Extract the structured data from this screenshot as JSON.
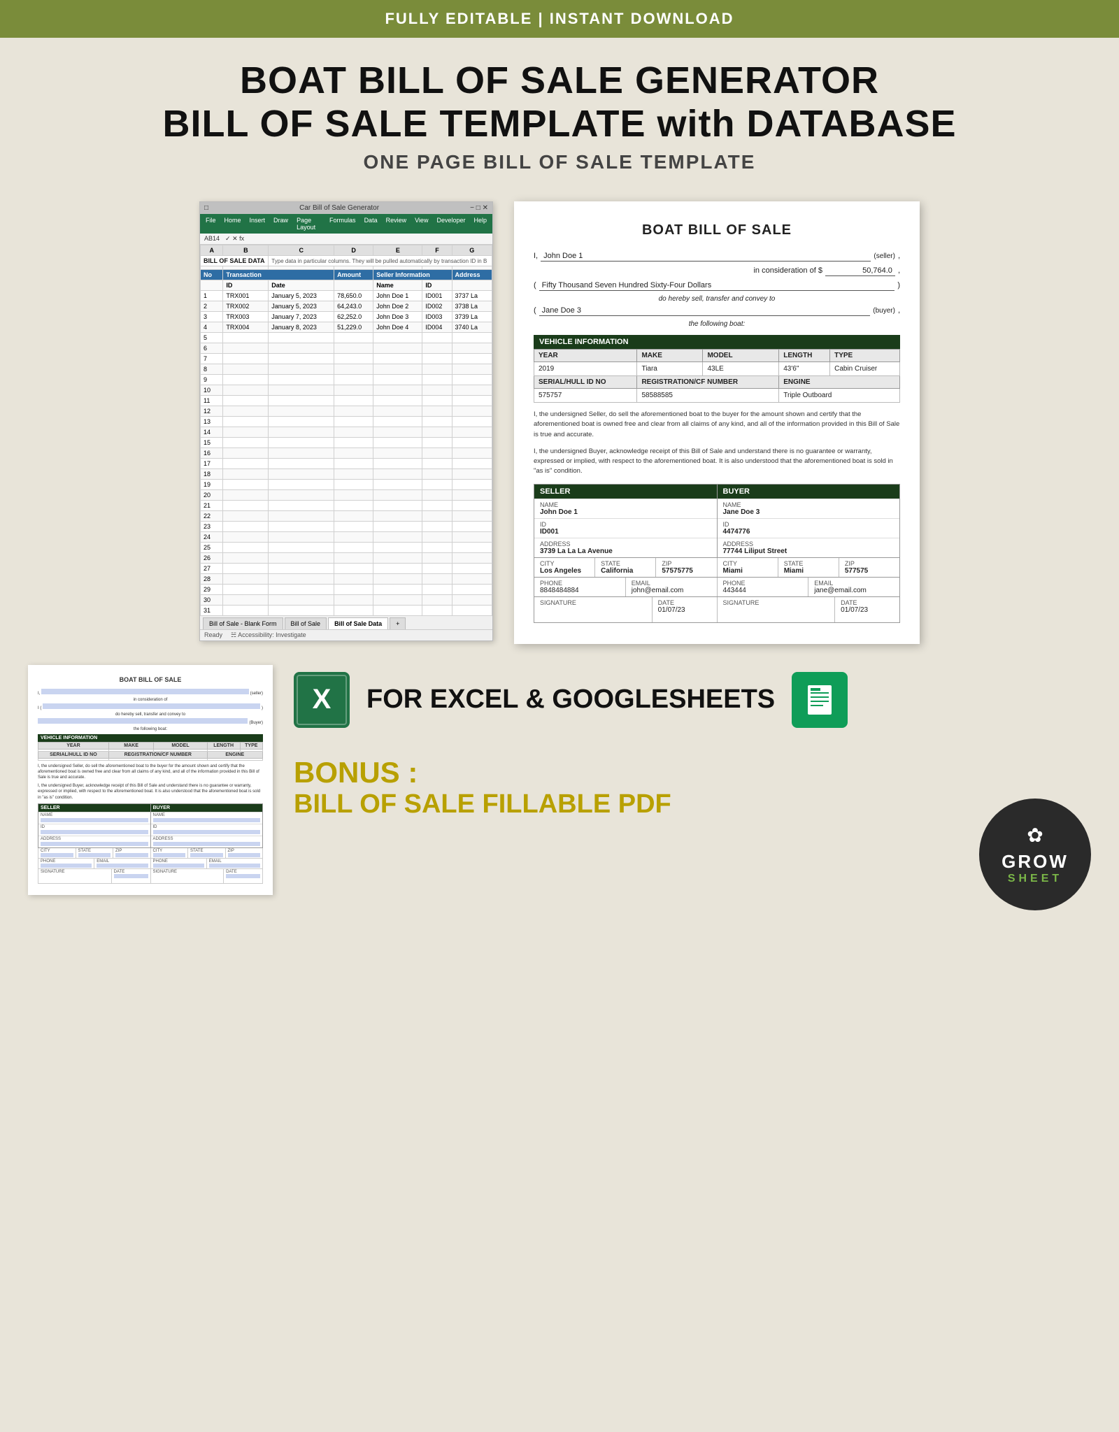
{
  "topBanner": {
    "text": "FULLY EDITABLE | INSTANT DOWNLOAD"
  },
  "mainTitle": {
    "line1": "BOAT BILL OF SALE GENERATOR",
    "line2": "BILL OF SALE TEMPLATE with DATABASE",
    "line3": "ONE PAGE BILL OF SALE TEMPLATE"
  },
  "excel": {
    "titleBar": "Car Bill of Sale Generator",
    "formulaBar": "AB14",
    "tabs": [
      "Bill of Sale - Blank Form",
      "Bill of Sale",
      "Bill of Sale Data"
    ],
    "activeTab": "Bill of Sale Data",
    "sheetTitle": "BILL OF SALE DATA",
    "sheetSubtitle": "Type data in particular columns. They will be pulled automatically by transaction ID in B",
    "columnHeaders": [
      "A",
      "B",
      "C",
      "D",
      "E",
      "F",
      "G"
    ],
    "tableHeaders": [
      "No",
      "Transaction",
      "",
      "Amount",
      "Seller Information",
      "",
      "ID",
      "Address"
    ],
    "subHeaders": [
      "",
      "ID",
      "Date",
      "",
      "Name",
      "",
      "",
      ""
    ],
    "rows": [
      {
        "no": "1",
        "id": "TRX001",
        "date": "January 5, 2023",
        "amount": "78,650.0",
        "name": "John Doe 1",
        "sid": "ID001",
        "addr": "3737 La"
      },
      {
        "no": "2",
        "id": "TRX002",
        "date": "January 5, 2023",
        "amount": "64,243.0",
        "name": "John Doe 2",
        "sid": "ID002",
        "addr": "3738 La"
      },
      {
        "no": "3",
        "id": "TRX003",
        "date": "January 7, 2023",
        "amount": "62,252.0",
        "name": "John Doe 3",
        "sid": "ID003",
        "addr": "3739 La"
      },
      {
        "no": "4",
        "id": "TRX004",
        "date": "January 8, 2023",
        "amount": "51,229.0",
        "name": "John Doe 4",
        "sid": "ID004",
        "addr": "3740 La"
      }
    ],
    "status": "Ready"
  },
  "billOfSale": {
    "title": "BOAT BILL OF SALE",
    "seller": "John Doe 1",
    "considerationLabel": "in consideration of $",
    "considerationAmount": "50,764.0",
    "amountWords": "Fifty Thousand Seven Hundred Sixty-Four Dollars",
    "transferLabel": "do hereby sell, transfer and convey to",
    "buyer": "Jane Doe 3",
    "buyerLabel": "(buyer)",
    "followingBoatLabel": "the following boat:",
    "vehicleInfoHeader": "VEHICLE INFORMATION",
    "vehicleTableHeaders": [
      "YEAR",
      "MAKE",
      "MODEL",
      "LENGTH",
      "TYPE"
    ],
    "vehicleRow": [
      "2019",
      "Tiara",
      "43LE",
      "43'6\"",
      "Cabin Cruiser"
    ],
    "vehicleRow2Headers": [
      "SERIAL/HULL ID NO",
      "REGISTRATION/CF NUMBER",
      "ENGINE"
    ],
    "vehicleRow2": [
      "575757",
      "58588585",
      "Triple Outboard"
    ],
    "sellerParagraph": "I, the undersigned Seller, do sell the aforementioned boat to the buyer for the amount shown and certify that the aforementioned boat is owned free and clear from all claims of any kind, and all of the information provided in this Bill of Sale is true and accurate.",
    "buyerParagraph": "I, the undersigned Buyer, acknowledge receipt of this Bill of Sale and understand there is no guarantee or warranty, expressed or implied, with respect to the aforementioned boat. It is also understood that the aforementioned boat is sold in \"as is\" condition.",
    "sellerHeader": "SELLER",
    "buyerHeader": "BUYER",
    "sellerInfo": {
      "nameLabel": "NAME",
      "name": "John Doe 1",
      "idLabel": "ID",
      "id": "ID001",
      "addressLabel": "ADDRESS",
      "address": "3739 La La La Avenue",
      "cityLabel": "CITY",
      "city": "Los Angeles",
      "stateLabel": "STATE",
      "state": "California",
      "zipLabel": "ZIP",
      "zip": "57575775",
      "phoneLabel": "PHONE",
      "phone": "8848484884",
      "emailLabel": "EMAIL",
      "email": "john@email.com",
      "sigLabel": "SIGNATURE",
      "dateLabel": "DATE",
      "date": "01/07/23"
    },
    "buyerInfo": {
      "nameLabel": "NAME",
      "name": "Jane Doe 3",
      "idLabel": "ID",
      "id": "4474776",
      "addressLabel": "ADDRESS",
      "address": "77744 Liliput Street",
      "cityLabel": "CITY",
      "city": "Miami",
      "stateLabel": "STATE",
      "state": "Miami",
      "zipLabel": "ZIP",
      "zip": "577575",
      "phoneLabel": "PHONE",
      "phone": "443444",
      "emailLabel": "EMAIL",
      "email": "jane@email.com",
      "sigLabel": "SIGNATURE",
      "dateLabel": "DATE",
      "date": "01/07/23"
    }
  },
  "platform": {
    "text": "FOR EXCEL & GOOGLESHEETS"
  },
  "growSheet": {
    "flower": "✿",
    "grow": "GROW",
    "sheet": "SHEET"
  },
  "bonus": {
    "title": "BONUS :",
    "subtitle": "BILL OF SALE FILLABLE PDF"
  }
}
